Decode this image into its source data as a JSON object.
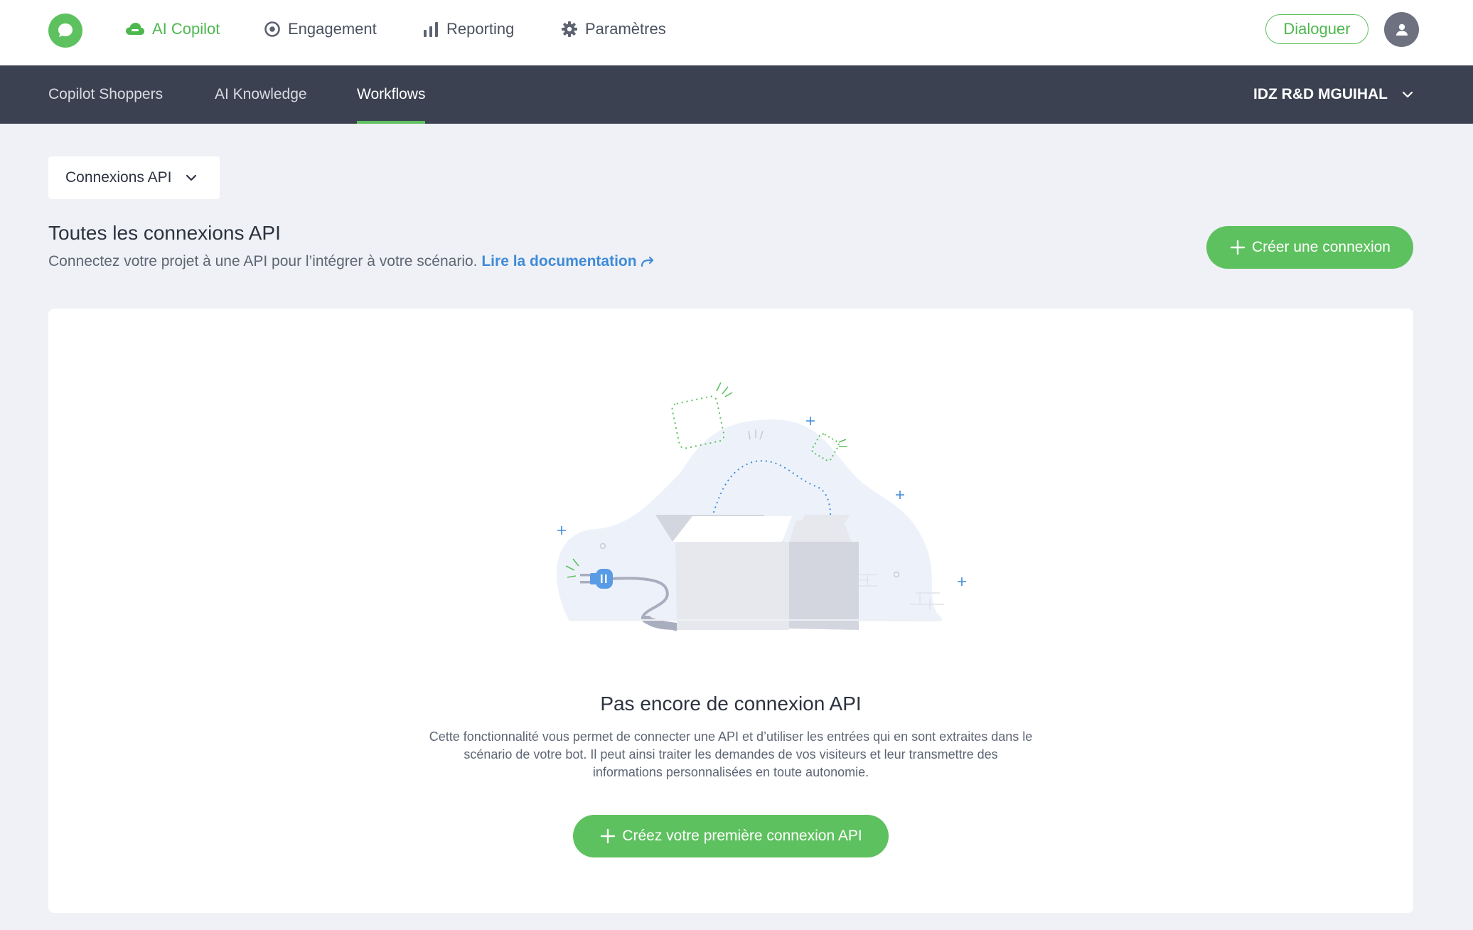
{
  "topnav": {
    "items": [
      {
        "label": "AI Copilot",
        "icon": "cloud-icon",
        "active": true
      },
      {
        "label": "Engagement",
        "icon": "target-icon",
        "active": false
      },
      {
        "label": "Reporting",
        "icon": "bar-chart-icon",
        "active": false
      },
      {
        "label": "Paramètres",
        "icon": "gear-icon",
        "active": false
      }
    ],
    "dialog_label": "Dialoguer"
  },
  "subnav": {
    "items": [
      {
        "label": "Copilot Shoppers",
        "active": false
      },
      {
        "label": "AI Knowledge",
        "active": false
      },
      {
        "label": "Workflows",
        "active": true
      }
    ],
    "org": "IDZ R&D MGUIHAL"
  },
  "filter": {
    "label": "Connexions API"
  },
  "header": {
    "title": "Toutes les connexions API",
    "subtitle": "Connectez votre projet à une API pour l’intégrer à votre scénario.",
    "doc_link": "Lire la documentation",
    "create_label": "Créer une connexion"
  },
  "empty": {
    "title": "Pas encore de connexion API",
    "desc_line1": "Cette fonctionnalité vous permet de connecter une API et d’utiliser les entrées qui en sont extraites dans le",
    "desc_line2": "scénario de votre bot. Il peut ainsi traiter les demandes de vos visiteurs et leur transmettre des",
    "desc_line3": "informations personnalisées en toute autonomie.",
    "cta_label": "Créez votre première connexion API"
  },
  "colors": {
    "accent": "#5ec15f",
    "subnav_bg": "#3b4150",
    "link": "#3f8ad8",
    "page_bg": "#eff1f6"
  }
}
